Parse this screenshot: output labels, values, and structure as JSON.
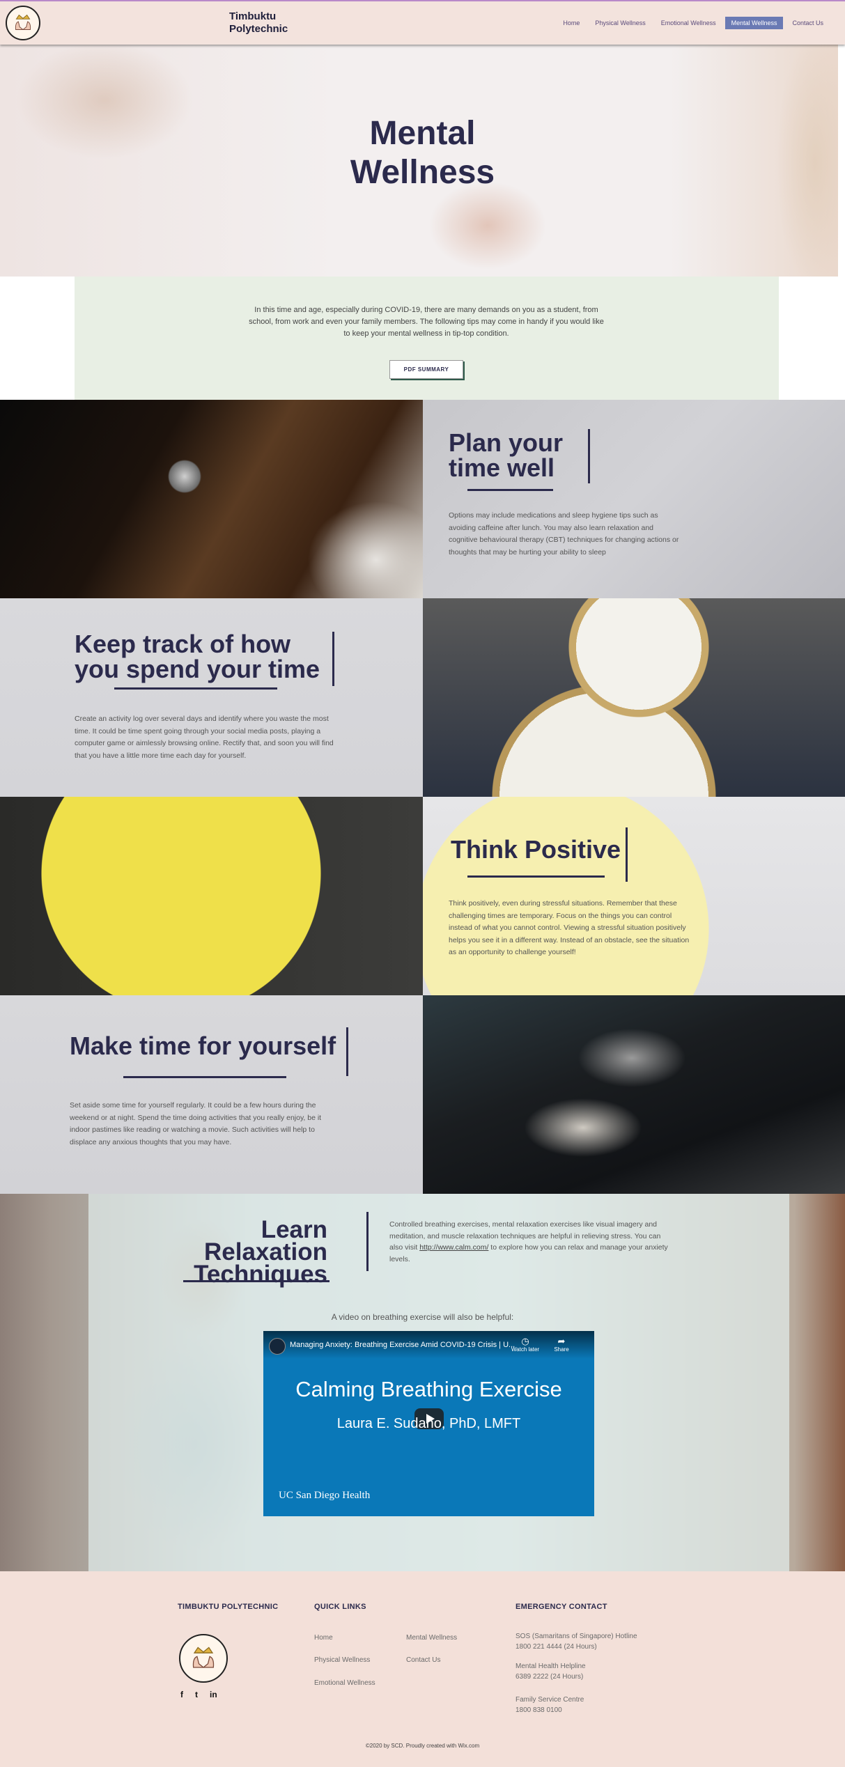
{
  "header": {
    "brand_line1": "Timbuktu",
    "brand_line2": "Polytechnic",
    "nav": [
      "Home",
      "Physical Wellness",
      "Emotional Wellness",
      "Mental Wellness",
      "Contact Us"
    ],
    "active_nav": "Mental Wellness"
  },
  "hero": {
    "title_line1": "Mental",
    "title_line2": "Wellness"
  },
  "intro": {
    "text": "In this time and age, especially during COVID-19, there are many demands on you as a student, from school, from work and even your family members. The following tips may come in handy if you would like to keep your mental wellness in tip-top condition.",
    "button": "PDF SUMMARY"
  },
  "sections": [
    {
      "title_line1": "Plan your",
      "title_line2": "time well",
      "text": "Options may include medications and sleep hygiene tips such as avoiding caffeine after lunch. You may also learn relaxation and cognitive behavioural therapy (CBT) techniques for changing actions or thoughts that may be hurting your ability to sleep"
    },
    {
      "title_line1": "Keep track of how",
      "title_line2": "you spend your time",
      "text": "Create an activity log over several days and identify where you waste the most time. It could be time spent going through your social media posts, playing a computer game or aimlessly browsing online. Rectify that, and soon you will find that you have a little more time each day for yourself."
    },
    {
      "title_line1": "Think Positive",
      "text": "Think positively, even during stressful situations. Remember that these challenging times are temporary. Focus on the things you can control instead of what you cannot control. Viewing a stressful situation positively helps you see it in a different way. Instead of an obstacle, see the situation as an opportunity to challenge yourself!"
    },
    {
      "title_line1": "Make time for yourself",
      "text": "Set aside some time for yourself regularly. It could be a few hours during the weekend or at night. Spend the time doing activities that you really enjoy, be it indoor pastimes like reading or watching a movie. Such activities will help to displace any anxious thoughts that you may have."
    }
  ],
  "relaxation": {
    "title_line1": "Learn Relaxation",
    "title_line2": "Techniques",
    "text_before_link": "Controlled breathing exercises, mental relaxation exercises like visual imagery and meditation, and muscle relaxation techniques are helpful in relieving stress. You can also visit ",
    "link": "http://www.calm.com/",
    "text_after_link": " to explore how you can relax and manage your anxiety levels.",
    "video_caption": "A video on breathing exercise will also be helpful:",
    "video": {
      "top_title": "Managing Anxiety: Breathing Exercise Amid COVID-19 Crisis | U...",
      "watch_later": "Watch later",
      "share": "Share",
      "main_title": "Calming Breathing Exercise",
      "subtitle": "Laura E. Sudano, PhD, LMFT",
      "brand": "UC San Diego Health"
    }
  },
  "footer": {
    "org": "TIMBUKTU POLYTECHNIC",
    "quick_links_title": "QUICK LINKS",
    "quick_links_col1": [
      "Home",
      "Physical Wellness",
      "Emotional Wellness"
    ],
    "quick_links_col2": [
      "Mental Wellness",
      "Contact Us"
    ],
    "emergency_title": "EMERGENCY CONTACT",
    "contacts": [
      {
        "name": "SOS (Samaritans of Singapore) Hotline",
        "number": "1800 221 4444 (24 Hours)"
      },
      {
        "name": "Mental Health Helpline",
        "number": "6389 2222 (24 Hours)"
      },
      {
        "name": "Family Service Centre",
        "number": "1800 838 0100"
      }
    ],
    "social": [
      "f",
      "t",
      "in"
    ],
    "copyright": "©2020 by SCD. Proudly created with Wix.com"
  },
  "colors": {
    "accent": "#6a7ab4",
    "title": "#2b2a4c",
    "footer_bg": "#f3e0d9",
    "intro_bg": "#e8efe4"
  }
}
